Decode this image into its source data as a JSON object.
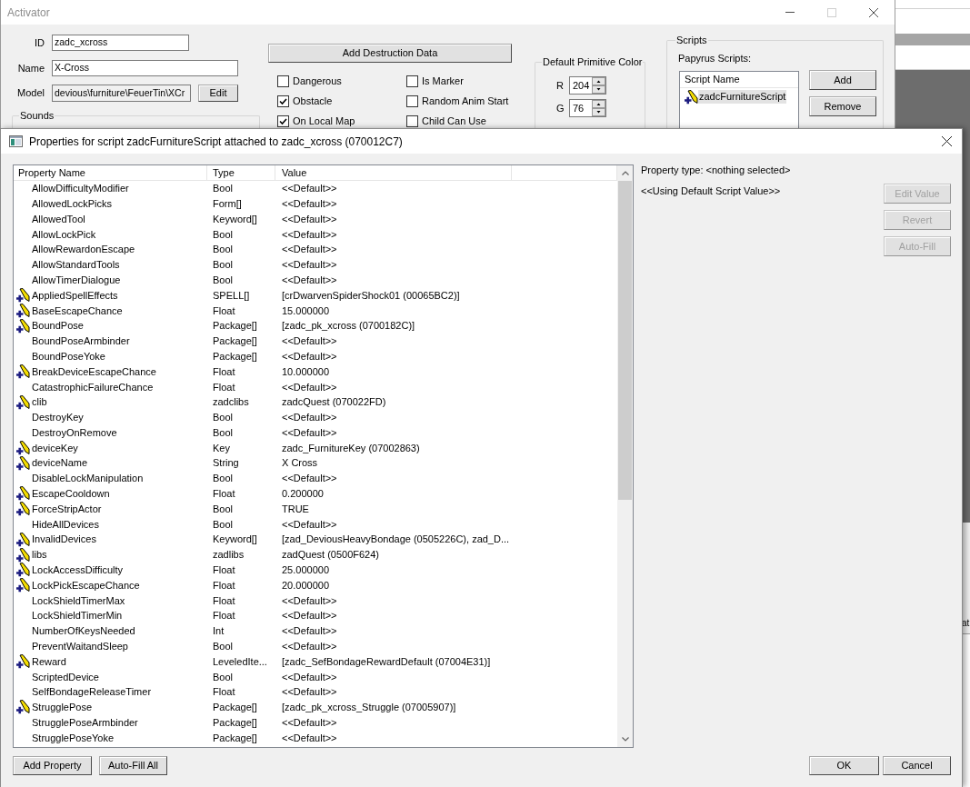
{
  "activator_window": {
    "title": "Activator",
    "window_buttons": [
      {
        "kind": "minimize",
        "disabled": false
      },
      {
        "kind": "maximize",
        "disabled": true
      },
      {
        "kind": "close",
        "disabled": false
      }
    ],
    "fields": [
      {
        "label": "ID",
        "value": "zadc_xcross",
        "read_only": false
      },
      {
        "label": "Name",
        "value": "X-Cross",
        "read_only": false
      },
      {
        "label": "Model",
        "value": "devious\\furniture\\FeuerTin\\XCr",
        "read_only": true,
        "button": "Edit"
      }
    ],
    "sounds_group": {
      "title": "Sounds"
    },
    "destruction_button": "Add Destruction Data",
    "flags": [
      {
        "label": "Dangerous",
        "checked": false
      },
      {
        "label": "Is Marker",
        "checked": false
      },
      {
        "label": "Obstacle",
        "checked": true
      },
      {
        "label": "Random Anim Start",
        "checked": false
      },
      {
        "label": "On Local Map",
        "checked": true
      },
      {
        "label": "Child Can Use",
        "checked": false
      }
    ],
    "primitive_color": {
      "title": "Default Primitive Color",
      "channels": [
        {
          "label": "R",
          "value": "204"
        },
        {
          "label": "G",
          "value": "76"
        }
      ]
    },
    "scripts": {
      "title": "Scripts",
      "list_label": "Papyrus Scripts:",
      "column": "Script Name",
      "items": [
        {
          "name": "zadcFurnitureScript",
          "selected": true
        }
      ],
      "buttons": [
        "Add",
        "Remove"
      ]
    }
  },
  "properties_dialog": {
    "title": "Properties for script zadcFurnitureScript attached to zadc_xcross (070012C7)",
    "columns": [
      "Property Name",
      "Type",
      "Value"
    ],
    "rows": [
      {
        "name": "AllowDifficultyModifier",
        "type": "Bool",
        "value": "<<Default>>",
        "edited": false
      },
      {
        "name": "AllowedLockPicks",
        "type": "Form[]",
        "value": "<<Default>>",
        "edited": false
      },
      {
        "name": "AllowedTool",
        "type": "Keyword[]",
        "value": "<<Default>>",
        "edited": false
      },
      {
        "name": "AllowLockPick",
        "type": "Bool",
        "value": "<<Default>>",
        "edited": false
      },
      {
        "name": "AllowRewardonEscape",
        "type": "Bool",
        "value": "<<Default>>",
        "edited": false
      },
      {
        "name": "AllowStandardTools",
        "type": "Bool",
        "value": "<<Default>>",
        "edited": false
      },
      {
        "name": "AllowTimerDialogue",
        "type": "Bool",
        "value": "<<Default>>",
        "edited": false
      },
      {
        "name": "AppliedSpellEffects",
        "type": "SPELL[]",
        "value": "[crDwarvenSpiderShock01 (00065BC2)]",
        "edited": true
      },
      {
        "name": "BaseEscapeChance",
        "type": "Float",
        "value": "15.000000",
        "edited": true
      },
      {
        "name": "BoundPose",
        "type": "Package[]",
        "value": "[zadc_pk_xcross (0700182C)]",
        "edited": true
      },
      {
        "name": "BoundPoseArmbinder",
        "type": "Package[]",
        "value": "<<Default>>",
        "edited": false
      },
      {
        "name": "BoundPoseYoke",
        "type": "Package[]",
        "value": "<<Default>>",
        "edited": false
      },
      {
        "name": "BreakDeviceEscapeChance",
        "type": "Float",
        "value": "10.000000",
        "edited": true
      },
      {
        "name": "CatastrophicFailureChance",
        "type": "Float",
        "value": "<<Default>>",
        "edited": false
      },
      {
        "name": "clib",
        "type": "zadclibs",
        "value": "zadcQuest (070022FD)",
        "edited": true
      },
      {
        "name": "DestroyKey",
        "type": "Bool",
        "value": "<<Default>>",
        "edited": false
      },
      {
        "name": "DestroyOnRemove",
        "type": "Bool",
        "value": "<<Default>>",
        "edited": false
      },
      {
        "name": "deviceKey",
        "type": "Key",
        "value": "zadc_FurnitureKey (07002863)",
        "edited": true
      },
      {
        "name": "deviceName",
        "type": "String",
        "value": "X Cross",
        "edited": true
      },
      {
        "name": "DisableLockManipulation",
        "type": "Bool",
        "value": "<<Default>>",
        "edited": false
      },
      {
        "name": "EscapeCooldown",
        "type": "Float",
        "value": "0.200000",
        "edited": true
      },
      {
        "name": "ForceStripActor",
        "type": "Bool",
        "value": "TRUE",
        "edited": true
      },
      {
        "name": "HideAllDevices",
        "type": "Bool",
        "value": "<<Default>>",
        "edited": false
      },
      {
        "name": "InvalidDevices",
        "type": "Keyword[]",
        "value": "[zad_DeviousHeavyBondage (0505226C), zad_D...",
        "edited": true
      },
      {
        "name": "libs",
        "type": "zadlibs",
        "value": "zadQuest (0500F624)",
        "edited": true
      },
      {
        "name": "LockAccessDifficulty",
        "type": "Float",
        "value": "25.000000",
        "edited": true
      },
      {
        "name": "LockPickEscapeChance",
        "type": "Float",
        "value": "20.000000",
        "edited": true
      },
      {
        "name": "LockShieldTimerMax",
        "type": "Float",
        "value": "<<Default>>",
        "edited": false
      },
      {
        "name": "LockShieldTimerMin",
        "type": "Float",
        "value": "<<Default>>",
        "edited": false
      },
      {
        "name": "NumberOfKeysNeeded",
        "type": "Int",
        "value": "<<Default>>",
        "edited": false
      },
      {
        "name": "PreventWaitandSleep",
        "type": "Bool",
        "value": "<<Default>>",
        "edited": false
      },
      {
        "name": "Reward",
        "type": "LeveledIte...",
        "value": "[zadc_SefBondageRewardDefault (07004E31)]",
        "edited": true
      },
      {
        "name": "ScriptedDevice",
        "type": "Bool",
        "value": "<<Default>>",
        "edited": false
      },
      {
        "name": "SelfBondageReleaseTimer",
        "type": "Float",
        "value": "<<Default>>",
        "edited": false
      },
      {
        "name": "StrugglePose",
        "type": "Package[]",
        "value": "[zadc_pk_xcross_Struggle (07005907)]",
        "edited": true
      },
      {
        "name": "StrugglePoseArmbinder",
        "type": "Package[]",
        "value": "<<Default>>",
        "edited": false
      },
      {
        "name": "StrugglePoseYoke",
        "type": "Package[]",
        "value": "<<Default>>",
        "edited": false
      }
    ],
    "property_type": "Property type: <nothing selected>",
    "value_note": "<<Using Default Script Value>>",
    "side_buttons": [
      {
        "label": "Edit Value",
        "disabled": true
      },
      {
        "label": "Revert",
        "disabled": true
      },
      {
        "label": "Auto-Fill",
        "disabled": true
      }
    ],
    "bottom_left_buttons": [
      "Add Property",
      "Auto-Fill All"
    ],
    "bottom_right_buttons": [
      "OK",
      "Cancel"
    ]
  },
  "background_window": {
    "fragment": "at"
  }
}
